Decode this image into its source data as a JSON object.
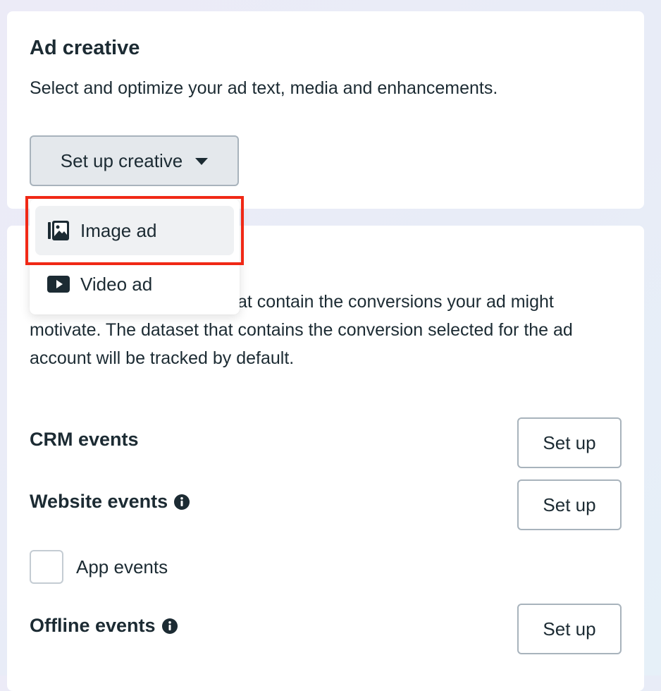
{
  "ad_creative": {
    "title": "Ad creative",
    "description": "Select and optimize your ad text, media and enhancements.",
    "setup_button_label": "Set up creative",
    "dropdown": {
      "items": [
        {
          "label": "Image ad",
          "icon": "image-icon"
        },
        {
          "label": "Video ad",
          "icon": "video-play-icon"
        }
      ]
    }
  },
  "tracking": {
    "description": "at contain the conversions your ad might motivate. The dataset that contains the conversion selected for the ad account will be tracked by default.",
    "rows": [
      {
        "title": "CRM events",
        "button_label": "Set up"
      },
      {
        "title": "Website events",
        "button_label": "Set up",
        "icon": "info-icon"
      },
      {
        "title": "Offline events",
        "button_label": "Set up",
        "icon": "info-icon"
      }
    ],
    "app_events_label": "App events"
  },
  "colors": {
    "highlight_border": "#f02815",
    "text": "#1c2b33",
    "button_bg": "#e4e8ec"
  }
}
